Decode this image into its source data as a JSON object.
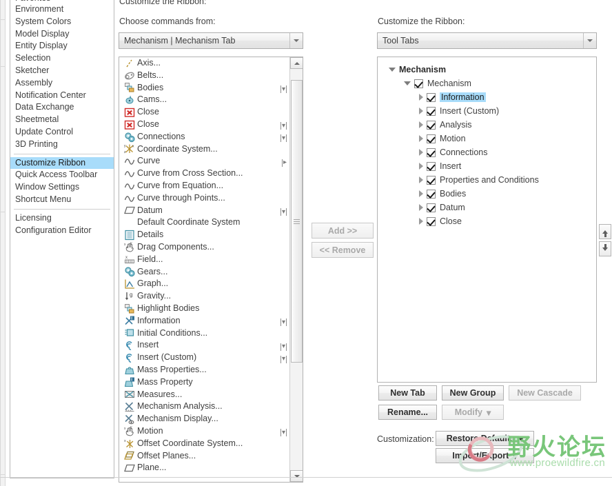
{
  "sidebar": {
    "items": [
      {
        "label": "Favorites",
        "selected": false,
        "clipped": true
      },
      {
        "label": "Environment",
        "selected": false
      },
      {
        "label": "System Colors",
        "selected": false
      },
      {
        "label": "Model Display",
        "selected": false
      },
      {
        "label": "Entity Display",
        "selected": false
      },
      {
        "label": "Selection",
        "selected": false
      },
      {
        "label": "Sketcher",
        "selected": false
      },
      {
        "label": "Assembly",
        "selected": false
      },
      {
        "label": "Notification Center",
        "selected": false
      },
      {
        "label": "Data Exchange",
        "selected": false
      },
      {
        "label": "Sheetmetal",
        "selected": false
      },
      {
        "label": "Update Control",
        "selected": false
      },
      {
        "label": "3D Printing",
        "selected": false
      },
      {
        "separator": true
      },
      {
        "label": "Customize Ribbon",
        "selected": true
      },
      {
        "label": "Quick Access Toolbar",
        "selected": false
      },
      {
        "label": "Window Settings",
        "selected": false
      },
      {
        "label": "Shortcut Menu",
        "selected": false
      },
      {
        "separator": true
      },
      {
        "label": "Licensing",
        "selected": false
      },
      {
        "label": "Configuration Editor",
        "selected": false
      }
    ]
  },
  "header": {
    "dialog_title": "Customize the Ribbon:",
    "choose_commands_label": "Choose commands from:",
    "customize_ribbon_label": "Customize the Ribbon:"
  },
  "commands_combo": {
    "value": "Mechanism | Mechanism Tab"
  },
  "ribbon_combo": {
    "value": "Tool Tabs"
  },
  "commands_list": {
    "items": [
      {
        "label": "Axis...",
        "icon": "axis-icon",
        "dropdown": "none"
      },
      {
        "label": "Belts...",
        "icon": "belts-icon",
        "dropdown": "none"
      },
      {
        "label": "Bodies",
        "icon": "bodies-icon",
        "dropdown": "split"
      },
      {
        "label": "Cams...",
        "icon": "cams-icon",
        "dropdown": "none"
      },
      {
        "label": "Close",
        "icon": "close-red-x-icon",
        "dropdown": "none"
      },
      {
        "label": "Close",
        "icon": "close-red-x-icon",
        "dropdown": "split"
      },
      {
        "label": "Connections",
        "icon": "connections-gears-icon",
        "dropdown": "split"
      },
      {
        "label": "Coordinate System...",
        "icon": "coordinate-system-icon",
        "dropdown": "none"
      },
      {
        "label": "Curve",
        "icon": "curve-icon",
        "dropdown": "flyout"
      },
      {
        "label": "Curve from Cross Section...",
        "icon": "curve-icon",
        "dropdown": "none"
      },
      {
        "label": "Curve from Equation...",
        "icon": "curve-icon",
        "dropdown": "none"
      },
      {
        "label": "Curve through Points...",
        "icon": "curve-icon",
        "dropdown": "none"
      },
      {
        "label": "Datum",
        "icon": "datum-plane-icon",
        "dropdown": "split"
      },
      {
        "label": "Default Coordinate System",
        "icon": "none",
        "dropdown": "none"
      },
      {
        "label": "Details",
        "icon": "details-icon",
        "dropdown": "none"
      },
      {
        "label": "Drag Components...",
        "icon": "drag-hand-icon",
        "dropdown": "none"
      },
      {
        "label": "Field...",
        "icon": "field-icon",
        "dropdown": "none"
      },
      {
        "label": "Gears...",
        "icon": "connections-gears-icon",
        "dropdown": "none"
      },
      {
        "label": "Graph...",
        "icon": "graph-icon",
        "dropdown": "none"
      },
      {
        "label": "Gravity...",
        "icon": "gravity-icon",
        "dropdown": "none"
      },
      {
        "label": "Highlight Bodies",
        "icon": "bodies-icon",
        "dropdown": "none"
      },
      {
        "label": "Information",
        "icon": "information-icon",
        "dropdown": "split"
      },
      {
        "label": "Initial Conditions...",
        "icon": "initial-conditions-icon",
        "dropdown": "none"
      },
      {
        "label": "Insert",
        "icon": "insert-spiral-icon",
        "dropdown": "split"
      },
      {
        "label": "Insert (Custom)",
        "icon": "insert-spiral-icon",
        "dropdown": "split"
      },
      {
        "label": "Mass Properties...",
        "icon": "mass-properties-icon",
        "dropdown": "none"
      },
      {
        "label": "Mass Property",
        "icon": "mass-property-icon",
        "dropdown": "none"
      },
      {
        "label": "Measures...",
        "icon": "measures-icon",
        "dropdown": "none"
      },
      {
        "label": "Mechanism Analysis...",
        "icon": "mechanism-analysis-icon",
        "dropdown": "none"
      },
      {
        "label": "Mechanism Display...",
        "icon": "mechanism-display-icon",
        "dropdown": "none"
      },
      {
        "label": "Motion",
        "icon": "drag-hand-icon",
        "dropdown": "split"
      },
      {
        "label": "Offset Coordinate System...",
        "icon": "offset-coord-sys-icon",
        "dropdown": "none"
      },
      {
        "label": "Offset Planes...",
        "icon": "offset-planes-icon",
        "dropdown": "none"
      },
      {
        "label": "Plane...",
        "icon": "datum-plane-icon",
        "dropdown": "none"
      }
    ]
  },
  "transfer": {
    "add_label": "Add >>",
    "remove_label": "<< Remove",
    "add_enabled": false,
    "remove_enabled": false
  },
  "ribbon_tree": {
    "nodes": [
      {
        "label": "Mechanism",
        "depth": 0,
        "expander": "down",
        "checkbox": false,
        "checked": false,
        "bold": true,
        "selected": false
      },
      {
        "label": "Mechanism",
        "depth": 1,
        "expander": "down",
        "checkbox": true,
        "checked": true,
        "bold": false,
        "selected": false
      },
      {
        "label": "Information",
        "depth": 2,
        "expander": "right",
        "checkbox": true,
        "checked": true,
        "bold": false,
        "selected": true
      },
      {
        "label": "Insert (Custom)",
        "depth": 2,
        "expander": "right",
        "checkbox": true,
        "checked": true,
        "bold": false,
        "selected": false
      },
      {
        "label": "Analysis",
        "depth": 2,
        "expander": "right",
        "checkbox": true,
        "checked": true,
        "bold": false,
        "selected": false
      },
      {
        "label": "Motion",
        "depth": 2,
        "expander": "right",
        "checkbox": true,
        "checked": true,
        "bold": false,
        "selected": false
      },
      {
        "label": "Connections",
        "depth": 2,
        "expander": "right",
        "checkbox": true,
        "checked": true,
        "bold": false,
        "selected": false
      },
      {
        "label": "Insert",
        "depth": 2,
        "expander": "right",
        "checkbox": true,
        "checked": true,
        "bold": false,
        "selected": false
      },
      {
        "label": "Properties and Conditions",
        "depth": 2,
        "expander": "right",
        "checkbox": true,
        "checked": true,
        "bold": false,
        "selected": false
      },
      {
        "label": "Bodies",
        "depth": 2,
        "expander": "right",
        "checkbox": true,
        "checked": true,
        "bold": false,
        "selected": false
      },
      {
        "label": "Datum",
        "depth": 2,
        "expander": "right",
        "checkbox": true,
        "checked": true,
        "bold": false,
        "selected": false
      },
      {
        "label": "Close",
        "depth": 2,
        "expander": "right",
        "checkbox": true,
        "checked": true,
        "bold": false,
        "selected": false
      }
    ]
  },
  "actions": {
    "new_tab": {
      "label": "New Tab",
      "enabled": true
    },
    "new_group": {
      "label": "New Group",
      "enabled": true
    },
    "new_cascade": {
      "label": "New Cascade",
      "enabled": false
    },
    "rename": {
      "label": "Rename...",
      "enabled": true
    },
    "modify": {
      "label": "Modify",
      "enabled": false,
      "has_dropdown": true
    }
  },
  "customization": {
    "label": "Customization:",
    "restore_defaults": {
      "label": "Restore Defaults",
      "has_dropdown": true
    },
    "import_export": {
      "label": "Import/Export",
      "has_dropdown": true
    }
  },
  "move_buttons": {
    "up_title": "Move Up",
    "down_title": "Move Down"
  },
  "watermark": {
    "text_cn": "野火论坛",
    "url": "www.proewildfire.cn"
  },
  "colors": {
    "selection_blue": "#a8dcfa",
    "icon_teal": "#3f8fa3",
    "close_red": "#d02b28",
    "watermark_green": "#79c67a",
    "border_gray": "#b2b2b2"
  }
}
